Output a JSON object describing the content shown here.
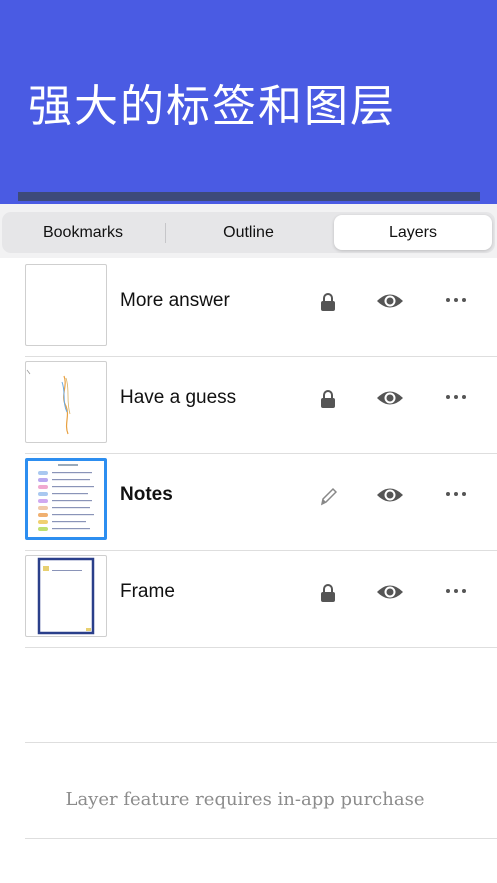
{
  "banner": {
    "title": "强大的标签和图层",
    "background": "#4a5be3"
  },
  "tabs": [
    {
      "label": "Bookmarks",
      "active": false
    },
    {
      "label": "Outline",
      "active": false
    },
    {
      "label": "Layers",
      "active": true
    }
  ],
  "layers": [
    {
      "name": "More answer",
      "status_icon": "lock-icon",
      "visible": true,
      "selected": false
    },
    {
      "name": "Have a guess",
      "status_icon": "lock-icon",
      "visible": true,
      "selected": false
    },
    {
      "name": "Notes",
      "status_icon": "pencil-icon",
      "visible": true,
      "selected": true
    },
    {
      "name": "Frame",
      "status_icon": "lock-icon",
      "visible": true,
      "selected": false
    }
  ],
  "footer": {
    "message": "Layer feature requires in-app purchase"
  },
  "colors": {
    "accent_blue": "#2d8ef0",
    "icon_gray": "#555555"
  }
}
